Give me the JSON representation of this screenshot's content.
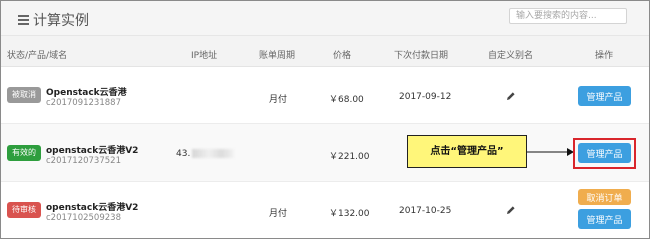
{
  "header": {
    "title": "计算实例",
    "search_placeholder": "输入要搜索的内容..."
  },
  "columns": [
    "状态/产品/域名",
    "IP地址",
    "账单周期",
    "价格",
    "下次付款日期",
    "自定义别名",
    "操作"
  ],
  "rows": [
    {
      "status": "被取消",
      "status_color": "#999999",
      "product": "Openstack云香港",
      "code": "c2017091231887",
      "ip": "",
      "cycle": "月付",
      "price": "￥68.00",
      "next_due": "2017-09-12",
      "actions": [
        "管理产品"
      ]
    },
    {
      "status": "有效的",
      "status_color": "#2e9e3e",
      "product": "openstack云香港V2",
      "code": "c2017120737521",
      "ip": "43.",
      "cycle": "",
      "price": "￥221.00",
      "next_due": "",
      "actions": [
        "管理产品"
      ]
    },
    {
      "status": "待审核",
      "status_color": "#d9534f",
      "product": "openstack云香港V2",
      "code": "c2017102509238",
      "ip": "",
      "cycle": "月付",
      "price": "￥132.00",
      "next_due": "2017-10-25",
      "actions": [
        "取消订单",
        "管理产品"
      ]
    }
  ],
  "annotation": {
    "text": "点击“管理产品”",
    "highlight_color": "#d9262c",
    "callout_color": "#fff67a"
  },
  "icons": {
    "title_icon": "list-icon",
    "alias_icon": "pencil-edit-icon"
  }
}
